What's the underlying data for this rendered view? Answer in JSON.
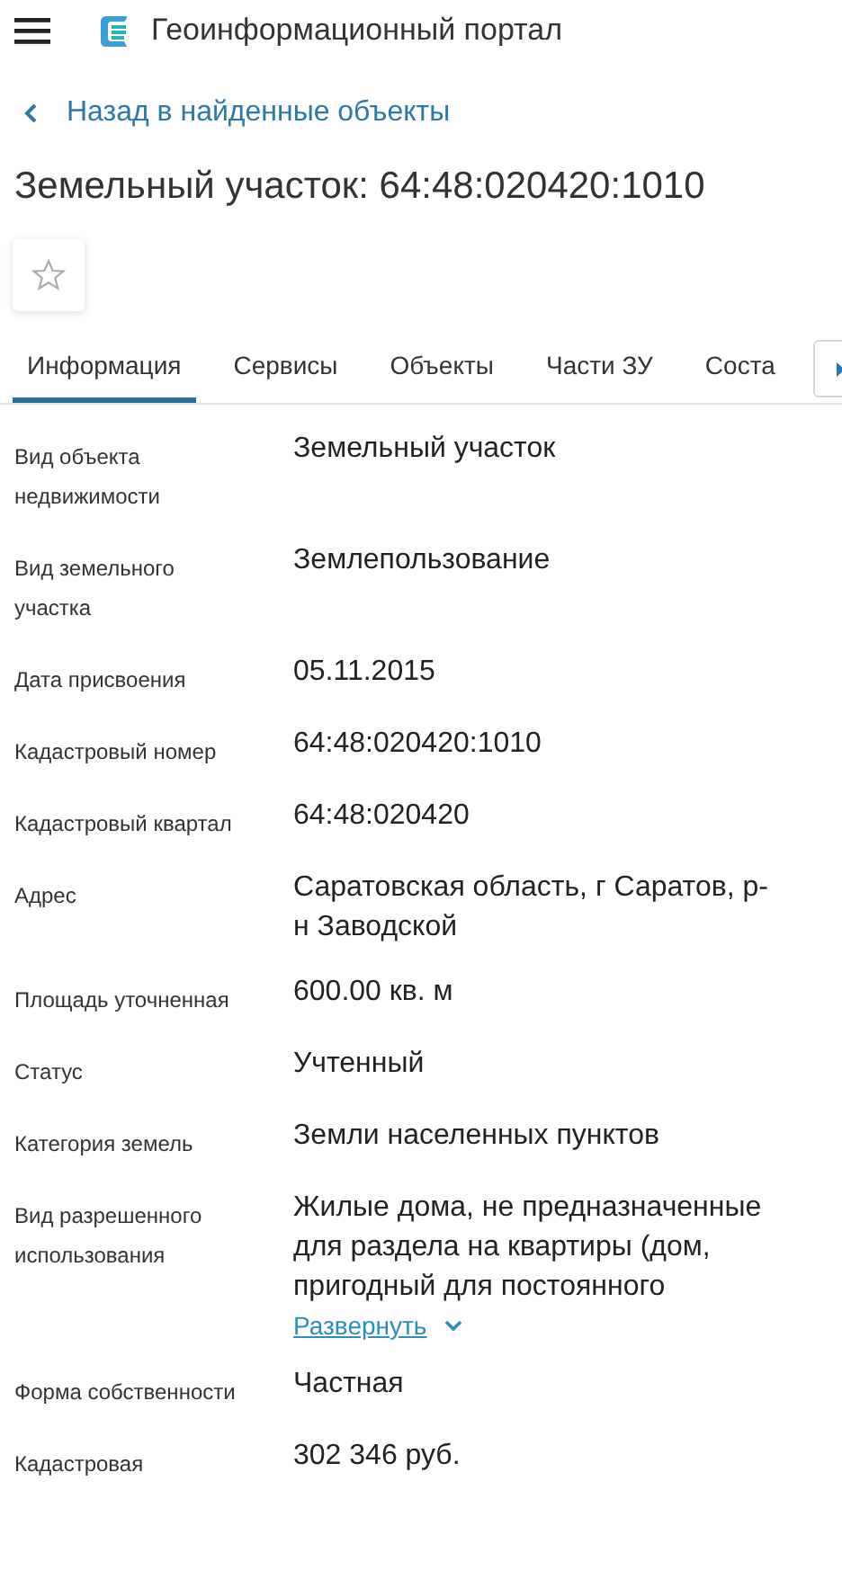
{
  "header": {
    "title": "Геоинформационный портал"
  },
  "back_link": {
    "label": "Назад в найденные объекты"
  },
  "title": "Земельный участок: 64:48:020420:1010",
  "favorite": {
    "selected": false
  },
  "tabs": [
    {
      "label": "Информация",
      "selected": true
    },
    {
      "label": "Сервисы",
      "selected": false
    },
    {
      "label": "Объекты",
      "selected": false
    },
    {
      "label": "Части ЗУ",
      "selected": false
    },
    {
      "label": "Соста",
      "selected": false
    }
  ],
  "rows": [
    {
      "label": "Вид объекта недвижимости",
      "value": "Земельный участок"
    },
    {
      "label": "Вид земельного участка",
      "value": "Землепользование"
    },
    {
      "label": "Дата присвоения",
      "value": "05.11.2015"
    },
    {
      "label": "Кадастровый номер",
      "value": "64:48:020420:1010"
    },
    {
      "label": "Кадастровый квартал",
      "value": "64:48:020420"
    },
    {
      "label": "Адрес",
      "value": "Саратовская область, г Саратов, р-н Заводской"
    },
    {
      "label": "Площадь уточненная",
      "value": "600.00 кв. м"
    },
    {
      "label": "Статус",
      "value": "Учтенный"
    },
    {
      "label": "Категория земель",
      "value": "Земли населенных пунктов"
    },
    {
      "label": "Вид разрешенного использования",
      "value": "Жилые дома, не предназначенные для раздела на квартиры (дом, пригодный для постоянного",
      "expand": "Развернуть"
    },
    {
      "label": "Форма собственности",
      "value": "Частная"
    },
    {
      "label": "Кадастровая",
      "value": "302 346 руб."
    }
  ]
}
